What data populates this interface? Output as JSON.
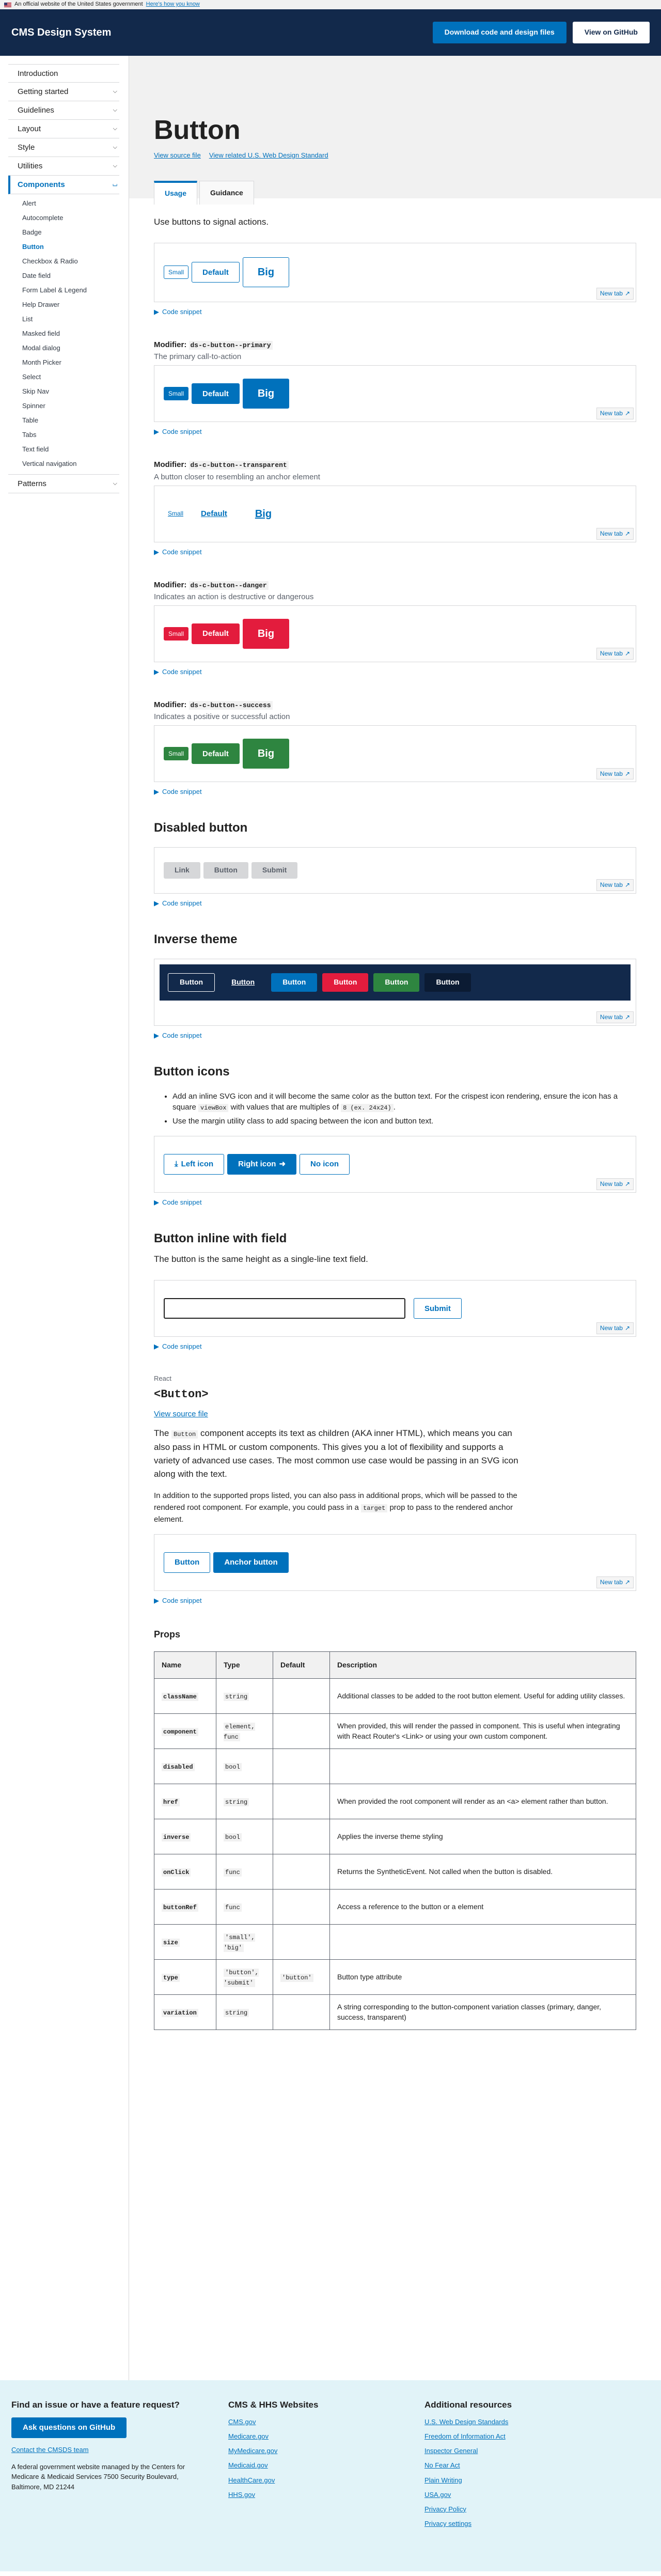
{
  "banner": {
    "text": "An official website of the United States government",
    "link": "Here's how you know"
  },
  "header": {
    "logo": "CMS Design System",
    "download": "Download code and design files",
    "github": "View on GitHub"
  },
  "nav": {
    "top": [
      "Introduction",
      "Getting started",
      "Guidelines",
      "Layout",
      "Style",
      "Utilities"
    ],
    "active": "Components",
    "sub": [
      "Alert",
      "Autocomplete",
      "Badge",
      "Button",
      "Checkbox & Radio",
      "Date field",
      "Form Label & Legend",
      "Help Drawer",
      "List",
      "Masked field",
      "Modal dialog",
      "Month Picker",
      "Select",
      "Skip Nav",
      "Spinner",
      "Table",
      "Tabs",
      "Text field",
      "Vertical navigation"
    ],
    "bottom": "Patterns"
  },
  "page": {
    "title": "Button",
    "source": "View source file",
    "related": "View related U.S. Web Design Standard",
    "tab_usage": "Usage",
    "tab_guidance": "Guidance",
    "lead": "Use buttons to signal actions.",
    "new_tab": "New tab",
    "snippet": "Code snippet",
    "sizes": {
      "sm": "Small",
      "md": "Default",
      "lg": "Big"
    }
  },
  "modifiers": {
    "primary": {
      "label": "Modifier:",
      "code": "ds-c-button--primary",
      "desc": "The primary call-to-action"
    },
    "transparent": {
      "label": "Modifier:",
      "code": "ds-c-button--transparent",
      "desc": "A button closer to resembling an anchor element"
    },
    "danger": {
      "label": "Modifier:",
      "code": "ds-c-button--danger",
      "desc": "Indicates an action is destructive or dangerous"
    },
    "success": {
      "label": "Modifier:",
      "code": "ds-c-button--success",
      "desc": "Indicates a positive or successful action"
    }
  },
  "disabled": {
    "title": "Disabled button",
    "link": "Link",
    "button": "Button",
    "submit": "Submit"
  },
  "inverse": {
    "title": "Inverse theme",
    "buttons": [
      "Button",
      "Button",
      "Button",
      "Button",
      "Button",
      "Button"
    ]
  },
  "icons": {
    "title": "Button icons",
    "b1a": "Add an inline SVG icon and it will become the same color as the button text. For the crispest icon rendering, ensure the icon has a square ",
    "b1code": "viewBox",
    "b1b": " with values that are multiples of ",
    "b1code2": "8 (ex. 24x24)",
    "b1c": ".",
    "b2": "Use the margin utility class to add spacing between the icon and button text.",
    "left": "Left icon",
    "right": "Right icon",
    "none": "No icon"
  },
  "inline": {
    "title": "Button inline with field",
    "desc": "The button is the same height as a single-line text field.",
    "submit": "Submit"
  },
  "react": {
    "label": "React",
    "title": "<Button>",
    "source": "View source file",
    "p1a": "The ",
    "p1code": "Button",
    "p1b": " component accepts its text as children (AKA inner HTML), which means you can also pass in HTML or custom components. This gives you a lot of flexibility and supports a variety of advanced use cases. The most common use case would be passing in an SVG icon along with the text.",
    "p2a": "In addition to the supported props listed, you can also pass in additional props, which will be passed to the rendered root component. For example, you could pass in a ",
    "p2code": "target",
    "p2b": " prop to pass to the rendered anchor element.",
    "btn1": "Button",
    "btn2": "Anchor button"
  },
  "props": {
    "title": "Props",
    "headers": [
      "Name",
      "Type",
      "Default",
      "Description"
    ],
    "rows": [
      {
        "name": "className",
        "type": "string",
        "default": "",
        "desc": "Additional classes to be added to the root button element. Useful for adding utility classes."
      },
      {
        "name": "component",
        "type": "element, func",
        "default": "",
        "desc": "When provided, this will render the passed in component. This is useful when integrating with React Router's <Link> or using your own custom component."
      },
      {
        "name": "disabled",
        "type": "bool",
        "default": "",
        "desc": ""
      },
      {
        "name": "href",
        "type": "string",
        "default": "",
        "desc": "When provided the root component will render as an <a> element rather than button."
      },
      {
        "name": "inverse",
        "type": "bool",
        "default": "",
        "desc": "Applies the inverse theme styling"
      },
      {
        "name": "onClick",
        "type": "func",
        "default": "",
        "desc": "Returns the SyntheticEvent. Not called when the button is disabled."
      },
      {
        "name": "buttonRef",
        "type": "func",
        "default": "",
        "desc": "Access a reference to the button or a element"
      },
      {
        "name": "size",
        "type": "'small', 'big'",
        "default": "",
        "desc": ""
      },
      {
        "name": "type",
        "type": "'button', 'submit'",
        "default": "'button'",
        "desc": "Button type attribute"
      },
      {
        "name": "variation",
        "type": "string",
        "default": "",
        "desc": "A string corresponding to the button-component variation classes (primary, danger, success, transparent)"
      }
    ]
  },
  "footer": {
    "issue_title": "Find an issue or have a feature request?",
    "gh": "Ask questions on GitHub",
    "contact": "Contact the CMSDS team",
    "address": "A federal government website managed by the Centers for Medicare & Medicaid Services 7500 Security Boulevard, Baltimore, MD 21244",
    "cms_title": "CMS & HHS Websites",
    "cms_links": [
      "CMS.gov",
      "Medicare.gov",
      "MyMedicare.gov",
      "Medicaid.gov",
      "HealthCare.gov",
      "HHS.gov"
    ],
    "res_title": "Additional resources",
    "res_links": [
      "U.S. Web Design Standards",
      "Freedom of Information Act",
      "Inspector General",
      "No Fear Act",
      "Plain Writing",
      "USA.gov",
      "Privacy Policy",
      "Privacy settings"
    ]
  }
}
